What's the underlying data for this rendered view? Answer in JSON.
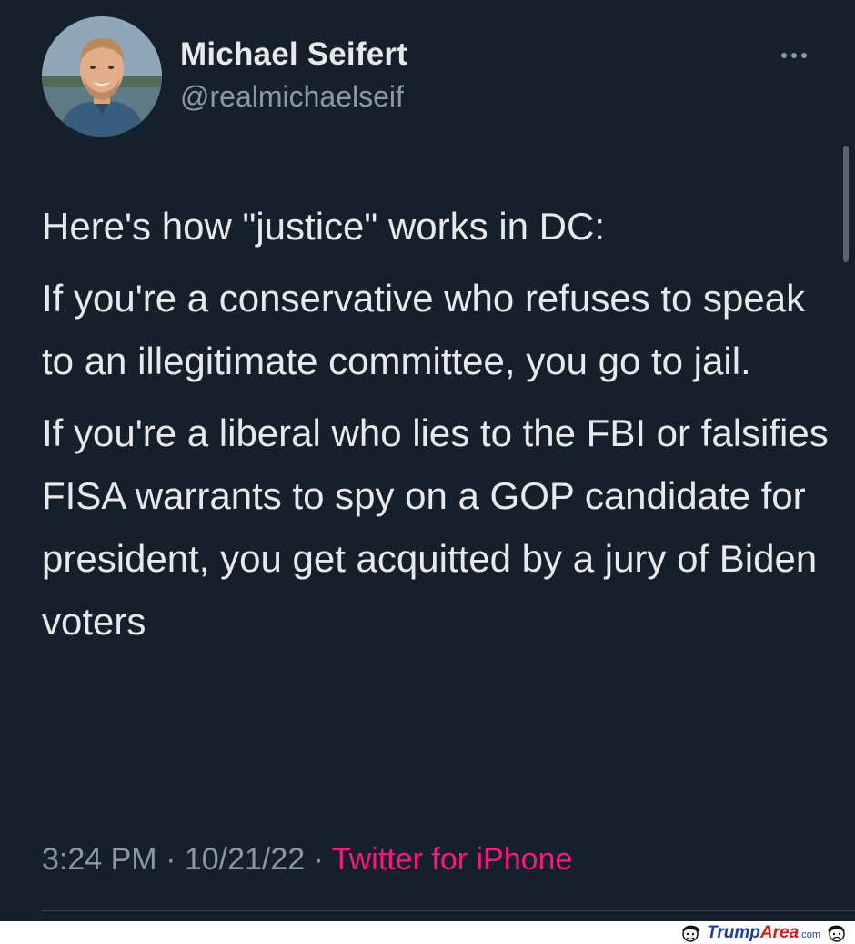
{
  "author": {
    "display_name": "Michael Seifert",
    "handle": "@realmichaelseif",
    "avatar_icon": "profile-photo"
  },
  "more_icon": "more-horizontal-icon",
  "tweet": {
    "paragraphs": [
      "Here's how \"justice\" works in DC:",
      "If you're a conservative who refuses to speak to an illegitimate committee, you go to jail.",
      "If you're a liberal who lies to the FBI or falsifies FISA warrants to spy on a GOP candidate for president, you get acquitted by a jury of Biden voters"
    ]
  },
  "meta": {
    "time": "3:24 PM",
    "separator": " · ",
    "date": "10/21/22",
    "source": "Twitter for iPhone"
  },
  "watermark": {
    "part1": "Trump",
    "part2": "Area",
    "part3": ".com"
  },
  "colors": {
    "background": "#15202b",
    "text": "#e7e9ea",
    "secondary": "#8b98a5",
    "source_link": "#f91880"
  }
}
